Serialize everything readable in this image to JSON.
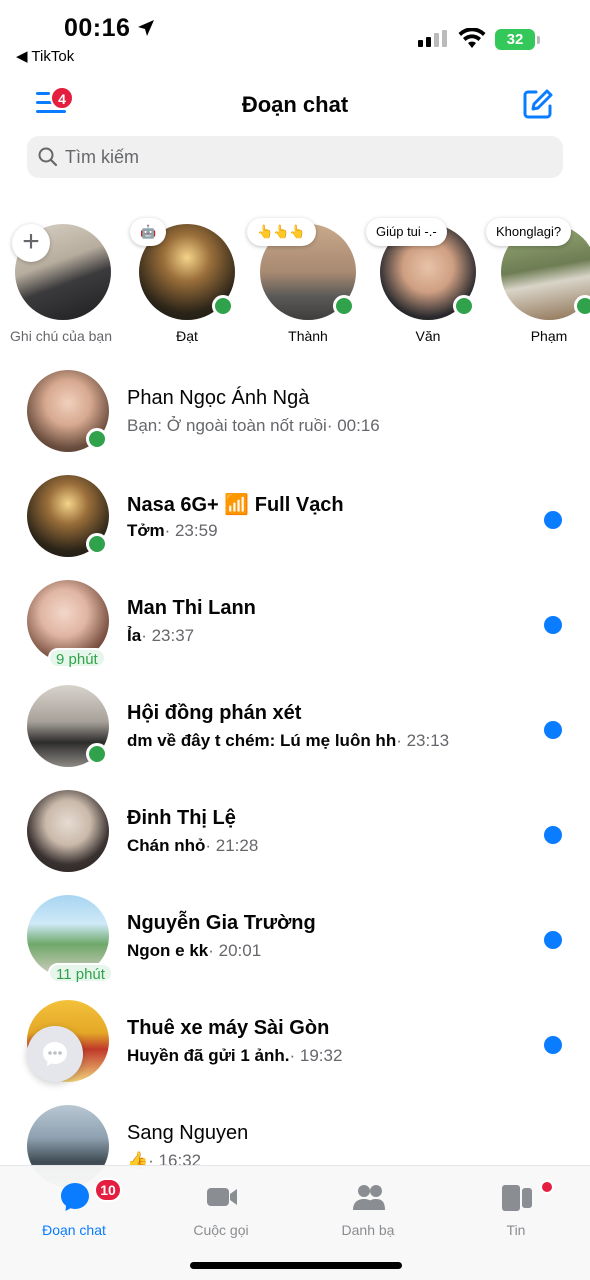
{
  "status_bar": {
    "time": "00:16",
    "back_app": "◀ TikTok",
    "battery": "32"
  },
  "header": {
    "title": "Đoạn chat",
    "menu_badge": "4"
  },
  "search": {
    "placeholder": "Tìm kiếm"
  },
  "stories": [
    {
      "name": "Ghi chú của bạn",
      "note": ""
    },
    {
      "name": "Đạt",
      "note": "🤖"
    },
    {
      "name": "Thành",
      "note": "👆👆👆"
    },
    {
      "name": "Văn",
      "note": "Giúp tui -.-"
    },
    {
      "name": "Phạm",
      "note": "Khonglagi?"
    }
  ],
  "chats": [
    {
      "name": "Phan Ngọc Ánh Ngà",
      "preview": "Bạn: Ở ngoài toàn nốt ruồi",
      "time": "· 00:16",
      "unread": false,
      "status": "online",
      "ago": ""
    },
    {
      "name": "Nasa 6G+ 📶 Full Vạch",
      "preview": "Tởm",
      "time": "· 23:59",
      "unread": true,
      "status": "online",
      "ago": ""
    },
    {
      "name": "Man Thi Lann",
      "preview": "Ỉa",
      "time": "· 23:37",
      "unread": true,
      "status": "ago",
      "ago": "9 phút"
    },
    {
      "name": "Hội đồng phán xét",
      "preview": "dm về đây t chém: Lú mẹ luôn hh",
      "time": "· 23:13",
      "unread": true,
      "status": "online",
      "ago": ""
    },
    {
      "name": "Đinh Thị Lệ",
      "preview": "Chán nhỏ",
      "time": "· 21:28",
      "unread": true,
      "status": "",
      "ago": ""
    },
    {
      "name": "Nguyễn Gia Trường",
      "preview": "Ngon e kk",
      "time": "· 20:01",
      "unread": true,
      "status": "ago",
      "ago": "11 phút"
    },
    {
      "name": "Thuê xe máy Sài Gòn",
      "preview": "Huyền đã gửi 1 ảnh.",
      "time": "· 19:32",
      "unread": true,
      "status": "",
      "ago": ""
    },
    {
      "name": "Sang Nguyen",
      "preview": "👍",
      "time": "· 16:32",
      "unread": false,
      "status": "",
      "ago": ""
    }
  ],
  "tabbar": {
    "chats_label": "Đoạn chat",
    "chats_badge": "10",
    "calls_label": "Cuộc gọi",
    "people_label": "Danh bạ",
    "stories_label": "Tin"
  },
  "colors": {
    "accent": "#0a7cff",
    "online": "#31a24c",
    "badge": "#e41e3f"
  },
  "icons": [
    "location-arrow-icon",
    "signal-icon",
    "wifi-icon",
    "battery-icon",
    "menu-icon",
    "compose-icon",
    "search-icon",
    "plus-icon",
    "chat-bubble-icon",
    "video-camera-icon",
    "people-icon",
    "stories-icon"
  ]
}
